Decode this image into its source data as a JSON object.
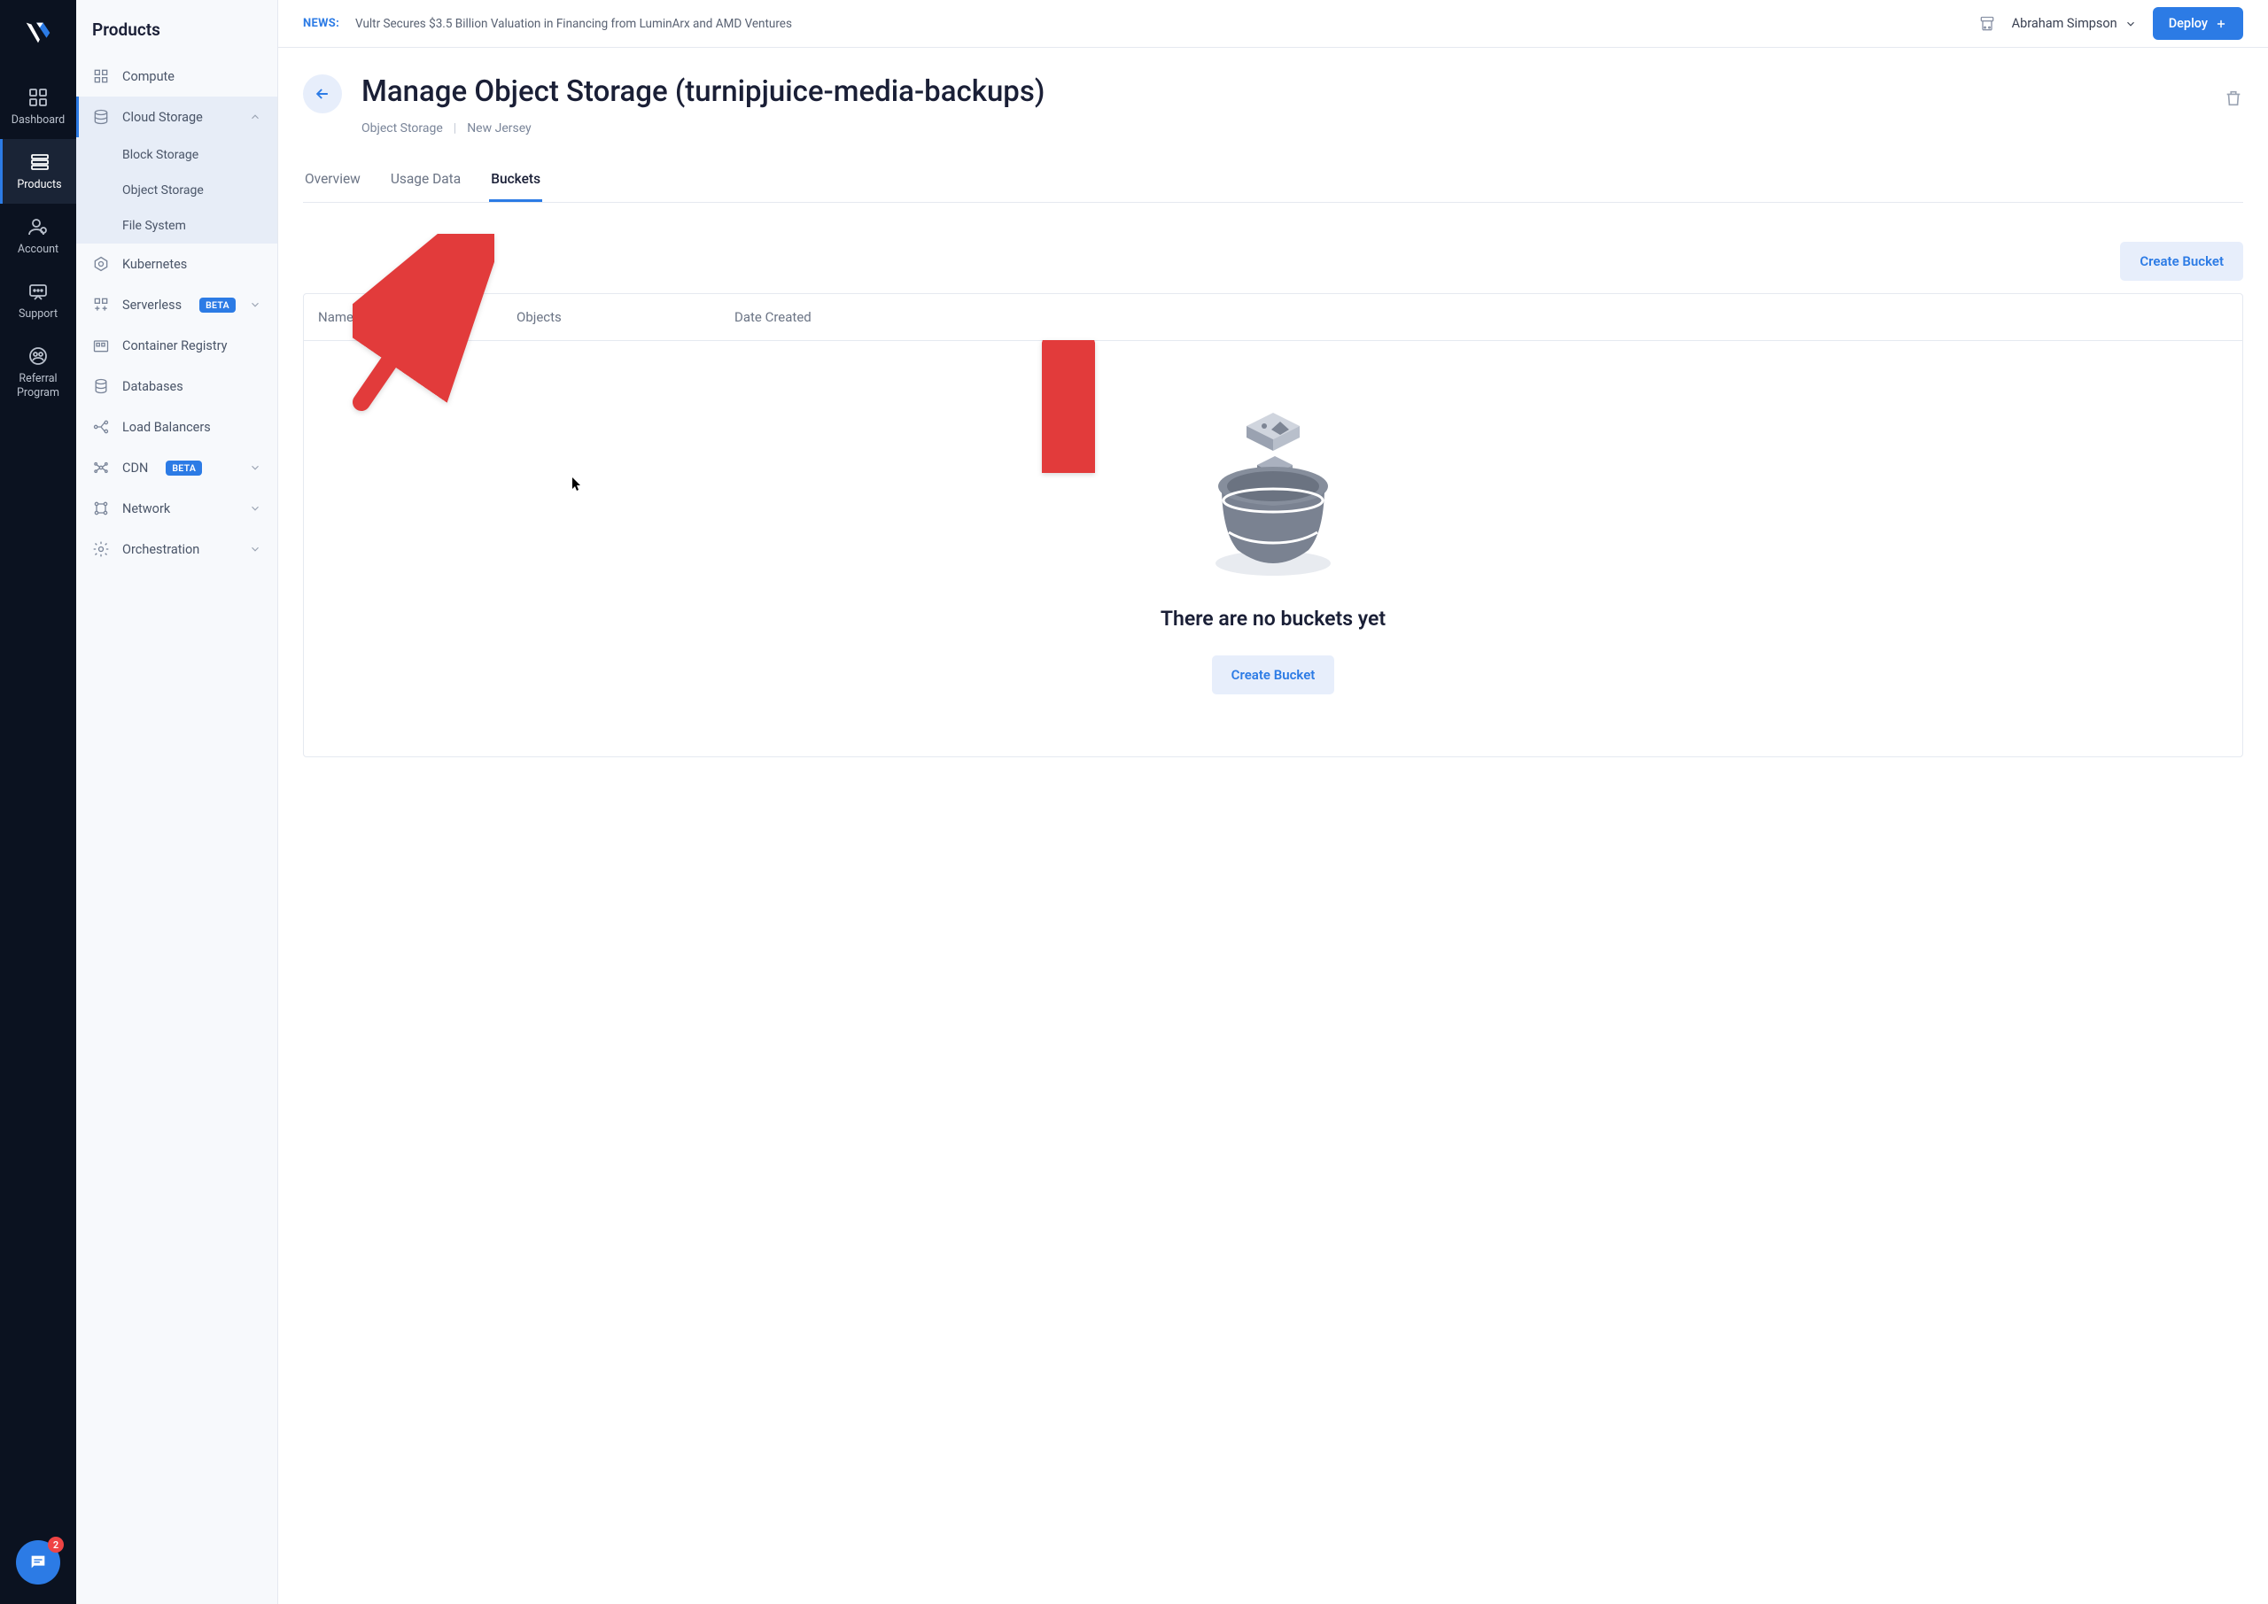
{
  "nav_rail": {
    "items": [
      {
        "label": "Dashboard"
      },
      {
        "label": "Products"
      },
      {
        "label": "Account"
      },
      {
        "label": "Support"
      },
      {
        "label": "Referral Program"
      }
    ],
    "chat_badge": "2"
  },
  "sidebar": {
    "title": "Products",
    "items": [
      {
        "label": "Compute"
      },
      {
        "label": "Cloud Storage",
        "expanded": true,
        "children": [
          {
            "label": "Block Storage"
          },
          {
            "label": "Object Storage"
          },
          {
            "label": "File System"
          }
        ]
      },
      {
        "label": "Kubernetes"
      },
      {
        "label": "Serverless",
        "badge": "BETA",
        "chev": true
      },
      {
        "label": "Container Registry"
      },
      {
        "label": "Databases"
      },
      {
        "label": "Load Balancers"
      },
      {
        "label": "CDN",
        "badge": "BETA",
        "chev": true
      },
      {
        "label": "Network",
        "chev": true
      },
      {
        "label": "Orchestration",
        "chev": true
      }
    ]
  },
  "topbar": {
    "news_label": "NEWS:",
    "news_text": "Vultr Secures $3.5 Billion Valuation in Financing from LuminArx and AMD Ventures",
    "user_name": "Abraham Simpson",
    "deploy_label": "Deploy"
  },
  "page": {
    "title": "Manage Object Storage (turnipjuice-media-backups)",
    "breadcrumb": {
      "product": "Object Storage",
      "location": "New Jersey"
    },
    "tabs": [
      {
        "label": "Overview"
      },
      {
        "label": "Usage Data"
      },
      {
        "label": "Buckets"
      }
    ],
    "create_button": "Create Bucket",
    "table": {
      "columns": {
        "name": "Name",
        "objects": "Objects",
        "date": "Date Created"
      }
    },
    "empty": {
      "title": "There are no buckets yet",
      "cta": "Create Bucket"
    }
  }
}
